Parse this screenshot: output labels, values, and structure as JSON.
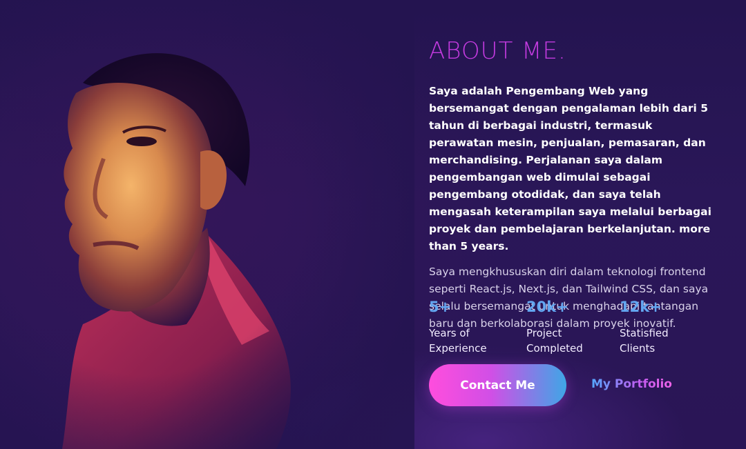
{
  "about": {
    "title": "ABOUT ME.",
    "paragraph_primary": "Saya adalah Pengembang Web yang bersemangat dengan pengalaman lebih dari 5 tahun di berbagai industri, termasuk perawatan mesin, penjualan, pemasaran, dan merchandising. Perjalanan saya dalam pengembangan web dimulai sebagai pengembang otodidak, dan saya telah mengasah keterampilan saya melalui berbagai proyek dan pembelajaran berkelanjutan. more than 5 years.",
    "paragraph_secondary": "Saya mengkhususkan diri dalam teknologi frontend seperti React.js, Next.js, dan Tailwind CSS, dan saya selalu bersemangat untuk menghadapi tantangan baru dan berkolaborasi dalam proyek inovatif."
  },
  "stats": [
    {
      "value": "5+",
      "label_line1": "Years of",
      "label_line2": "Experience"
    },
    {
      "value": "20k+",
      "label_line1": "Project",
      "label_line2": "Completed"
    },
    {
      "value": "12k+",
      "label_line1": "Statisfied",
      "label_line2": "Clients"
    }
  ],
  "actions": {
    "contact_label": "Contact Me",
    "portfolio_label": "My Portfolio"
  },
  "colors": {
    "background": "#241450",
    "title": "#c43be0",
    "stat_value": "#63a6f0",
    "button_gradient_start": "#ff4ddd",
    "button_gradient_end": "#3fa6e6"
  }
}
